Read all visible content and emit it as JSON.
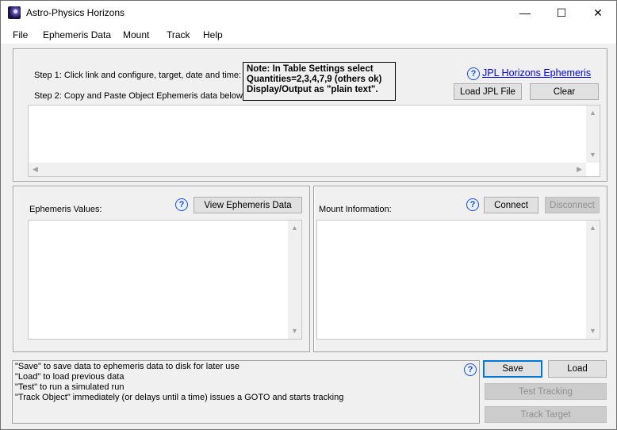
{
  "window": {
    "title": "Astro-Physics Horizons",
    "minimize": "—",
    "maximize": "☐",
    "close": "✕"
  },
  "menu": [
    "File",
    "Ephemeris Data",
    "Mount",
    "Track",
    "Help"
  ],
  "top": {
    "step1": "Step 1: Click link and configure, target, date and time:",
    "step2": "Step 2: Copy and Paste Object Ephemeris data below",
    "note": [
      "Note: In Table Settings select",
      "Quantities=2,3,4,7,9 (others ok)",
      "Display/Output as \"plain text\"."
    ],
    "help": "?",
    "link": "JPL Horizons Ephemeris",
    "load_jpl": "Load JPL File",
    "clear": "Clear",
    "ephemeris_text": ""
  },
  "ephemeris": {
    "label": "Ephemeris Values:",
    "help": "?",
    "view_button": "View Ephemeris Data",
    "text": ""
  },
  "mount": {
    "label": "Mount Information:",
    "help": "?",
    "connect": "Connect",
    "disconnect": "Disconnect",
    "text": ""
  },
  "status": {
    "lines": [
      "\"Save\" to save data to ephemeris data to disk for later use",
      "\"Load\" to load previous data",
      "\"Test\" to run a simulated run",
      "\"Track Object\" immediately (or delays until a time)  issues a GOTO and starts tracking"
    ],
    "help": "?"
  },
  "actions": {
    "save": "Save",
    "load": "Load",
    "test_tracking": "Test Tracking",
    "track_target": "Track Target"
  }
}
